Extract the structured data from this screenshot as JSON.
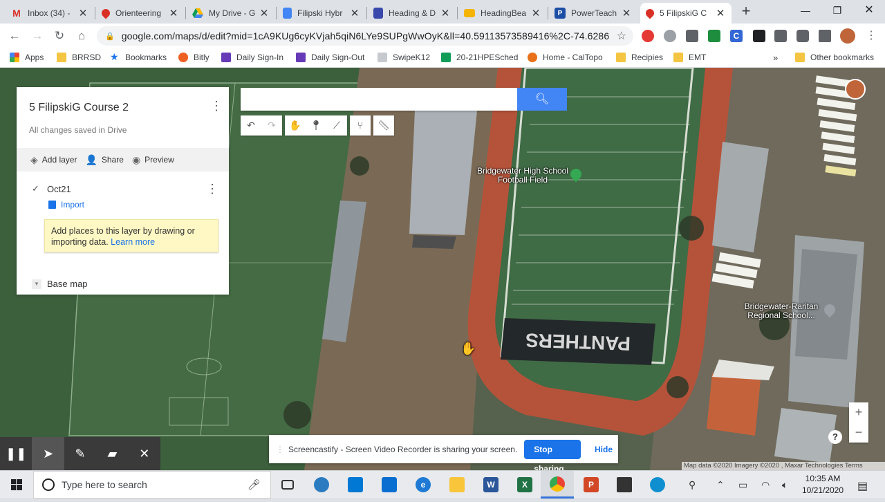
{
  "tabs": [
    {
      "title": "Inbox (34) -",
      "icon": "gmail-icon",
      "color": "#d93025",
      "glyph": "M"
    },
    {
      "title": "Orienteering",
      "icon": "maps-pin-icon",
      "color": "#d93025",
      "glyph": ""
    },
    {
      "title": "My Drive - G",
      "icon": "drive-icon",
      "color": "#1fa463",
      "glyph": ""
    },
    {
      "title": "Filipski Hybr",
      "icon": "docs-icon",
      "color": "#4285f4",
      "glyph": ""
    },
    {
      "title": "Heading & D",
      "icon": "forms-icon",
      "color": "#3949ab",
      "glyph": ""
    },
    {
      "title": "HeadingBea",
      "icon": "slides-icon",
      "color": "#f4b400",
      "glyph": ""
    },
    {
      "title": "PowerTeach",
      "icon": "powerteacher-icon",
      "color": "#1c4ea5",
      "glyph": "P"
    },
    {
      "title": "5 FilipskiG C",
      "icon": "maps-pin-icon",
      "color": "#d93025",
      "glyph": ""
    }
  ],
  "url": "google.com/maps/d/edit?mid=1cA9KUg6cyKVjah5qiN6LYe9SUPgWwOyK&ll=40.59113573589416%2C-74.6286...",
  "bookmarks": [
    {
      "label": "Apps",
      "icon": "apps-grid-icon",
      "color": "#4285f4"
    },
    {
      "label": "BRRSD",
      "icon": "folder-icon",
      "color": "#f4c542"
    },
    {
      "label": "Bookmarks",
      "icon": "star-icon",
      "color": "#1a73e8"
    },
    {
      "label": "Bitly",
      "icon": "bitly-icon",
      "color": "#ee6123"
    },
    {
      "label": "Daily Sign-In",
      "icon": "forms-icon",
      "color": "#673ab7"
    },
    {
      "label": "Daily Sign-Out",
      "icon": "forms-icon",
      "color": "#673ab7"
    },
    {
      "label": "SwipeK12",
      "icon": "swipek12-icon",
      "color": "#9aa0a6"
    },
    {
      "label": "20-21HPESched",
      "icon": "sheets-icon",
      "color": "#0f9d58"
    },
    {
      "label": "Home - CalTopo",
      "icon": "caltopo-icon",
      "color": "#e8711a"
    },
    {
      "label": "Recipies",
      "icon": "folder-icon",
      "color": "#f4c542"
    },
    {
      "label": "EMT",
      "icon": "folder-icon",
      "color": "#f4c542"
    },
    {
      "label": "Other bookmarks",
      "icon": "folder-icon",
      "color": "#f4c542"
    }
  ],
  "panel": {
    "title": "5 FilipskiG Course 2",
    "status": "All changes saved in Drive",
    "actions": {
      "add_layer": "Add layer",
      "share": "Share",
      "preview": "Preview"
    },
    "layer_name": "Oct21",
    "import_label": "Import",
    "tip_text": "Add places to this layer by drawing or importing data.",
    "tip_link": "Learn more",
    "base_map": "Base map"
  },
  "map": {
    "labels": {
      "field": "Bridgewater High School Football Field",
      "school": "Bridgewater-Raritan Regional School..."
    },
    "endzone_text": "PANTHERS",
    "attribution": "Map data ©2020 Imagery ©2020 , Maxar Technologies    Terms",
    "zoom_in": "+",
    "zoom_out": "−"
  },
  "sharebar": {
    "message": "Screencastify - Screen Video Recorder is sharing your screen.",
    "stop": "Stop sharing",
    "hide": "Hide"
  },
  "taskbar": {
    "search_placeholder": "Type here to search",
    "time": "10:35 AM",
    "date": "10/21/2020"
  },
  "colors": {
    "accent": "#1a73e8",
    "map_search_button": "#4285f4",
    "track": "#b5533a",
    "turf": "#3f6b45"
  }
}
